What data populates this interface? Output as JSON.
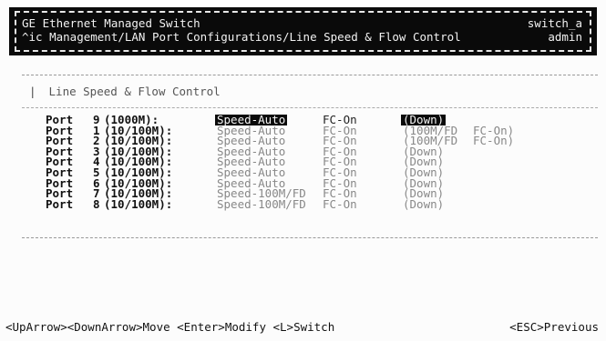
{
  "header": {
    "title": "GE Ethernet Managed Switch",
    "path": "^ic Management/LAN Port Configurations/Line Speed & Flow Control",
    "host": "switch_a",
    "user": "admin"
  },
  "panel": {
    "title": "Line Speed & Flow Control"
  },
  "ports": [
    {
      "port_label": "Port",
      "num": "9",
      "type": "(1000M):",
      "speed": "Speed-Auto",
      "fc": "FC-On",
      "link": "(Down)",
      "fc_status": "",
      "selected": true
    },
    {
      "port_label": "Port",
      "num": "1",
      "type": "(10/100M):",
      "speed": "Speed-Auto",
      "fc": "FC-On",
      "link": "(100M/FD",
      "fc_status": "FC-On)",
      "selected": false
    },
    {
      "port_label": "Port",
      "num": "2",
      "type": "(10/100M):",
      "speed": "Speed-Auto",
      "fc": "FC-On",
      "link": "(100M/FD",
      "fc_status": "FC-On)",
      "selected": false
    },
    {
      "port_label": "Port",
      "num": "3",
      "type": "(10/100M):",
      "speed": "Speed-Auto",
      "fc": "FC-On",
      "link": "(Down)",
      "fc_status": "",
      "selected": false
    },
    {
      "port_label": "Port",
      "num": "4",
      "type": "(10/100M):",
      "speed": "Speed-Auto",
      "fc": "FC-On",
      "link": "(Down)",
      "fc_status": "",
      "selected": false
    },
    {
      "port_label": "Port",
      "num": "5",
      "type": "(10/100M):",
      "speed": "Speed-Auto",
      "fc": "FC-On",
      "link": "(Down)",
      "fc_status": "",
      "selected": false
    },
    {
      "port_label": "Port",
      "num": "6",
      "type": "(10/100M):",
      "speed": "Speed-Auto",
      "fc": "FC-On",
      "link": "(Down)",
      "fc_status": "",
      "selected": false
    },
    {
      "port_label": "Port",
      "num": "7",
      "type": "(10/100M):",
      "speed": "Speed-100M/FD",
      "fc": "FC-On",
      "link": "(Down)",
      "fc_status": "",
      "selected": false
    },
    {
      "port_label": "Port",
      "num": "8",
      "type": "(10/100M):",
      "speed": "Speed-100M/FD",
      "fc": "FC-On",
      "link": "(Down)",
      "fc_status": "",
      "selected": false
    }
  ],
  "footer": {
    "keys": "<UpArrow><DownArrow>Move <Enter>Modify <L>Switch",
    "escape": "<ESC>Previous"
  }
}
